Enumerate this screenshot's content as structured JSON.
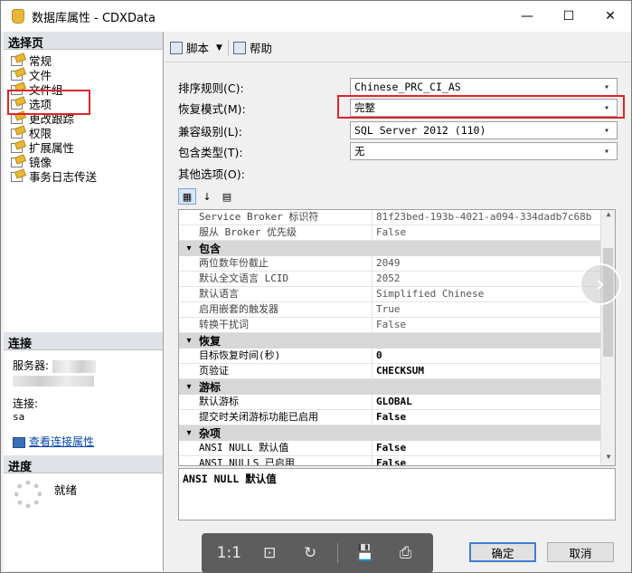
{
  "window": {
    "title": "数据库属性 - CDXData",
    "minimize": "—",
    "maximize": "☐",
    "close": "✕"
  },
  "left": {
    "select_page_header": "选择页",
    "pages": [
      "常规",
      "文件",
      "文件组",
      "选项",
      "更改跟踪",
      "权限",
      "扩展属性",
      "镜像",
      "事务日志传送"
    ],
    "connection_header": "连接",
    "server_label": "服务器:",
    "connect_label": "连接:",
    "connect_value": "sa",
    "view_connection_link": "查看连接属性",
    "progress_header": "进度",
    "progress_status": "就绪"
  },
  "toolbar": {
    "script_label": "脚本",
    "help_label": "帮助"
  },
  "form": {
    "collation_label": "排序规则(C):",
    "collation_value": "Chinese_PRC_CI_AS",
    "recovery_label": "恢复模式(M):",
    "recovery_value": "完整",
    "compat_label": "兼容级别(L):",
    "compat_value": "SQL Server 2012 (110)",
    "containment_label": "包含类型(T):",
    "containment_value": "无",
    "other_options_label": "其他选项(O):"
  },
  "grid": {
    "rows": [
      {
        "type": "row",
        "name": "Service Broker 标识符",
        "value": "81f23bed-193b-4021-a094-334dadb7c68b",
        "editable": false
      },
      {
        "type": "row",
        "name": "服从 Broker 优先级",
        "value": "False",
        "editable": false
      },
      {
        "type": "cat",
        "name": "包含"
      },
      {
        "type": "row",
        "name": "两位数年份截止",
        "value": "2049",
        "editable": false
      },
      {
        "type": "row",
        "name": "默认全文语言 LCID",
        "value": "2052",
        "editable": false
      },
      {
        "type": "row",
        "name": "默认语言",
        "value": "Simplified Chinese",
        "editable": false
      },
      {
        "type": "row",
        "name": "启用嵌套的触发器",
        "value": "True",
        "editable": false
      },
      {
        "type": "row",
        "name": "转换干扰词",
        "value": "False",
        "editable": false
      },
      {
        "type": "cat",
        "name": "恢复"
      },
      {
        "type": "row",
        "name": "目标恢复时间(秒)",
        "value": "0",
        "editable": true
      },
      {
        "type": "row",
        "name": "页验证",
        "value": "CHECKSUM",
        "editable": true
      },
      {
        "type": "cat",
        "name": "游标"
      },
      {
        "type": "row",
        "name": "默认游标",
        "value": "GLOBAL",
        "editable": true
      },
      {
        "type": "row",
        "name": "提交时关闭游标功能已启用",
        "value": "False",
        "editable": true
      },
      {
        "type": "cat",
        "name": "杂项"
      },
      {
        "type": "row",
        "name": "ANSI NULL 默认值",
        "value": "False",
        "editable": true
      },
      {
        "type": "row",
        "name": "ANSI NULLS 已启用",
        "value": "False",
        "editable": true
      }
    ]
  },
  "description": "ANSI NULL 默认值",
  "viewer": {
    "actual_size": "1:1",
    "fit": "⊡",
    "rotate": "↻",
    "save": "💾",
    "print": "⎙"
  },
  "buttons": {
    "ok": "确定",
    "cancel": "取消"
  }
}
